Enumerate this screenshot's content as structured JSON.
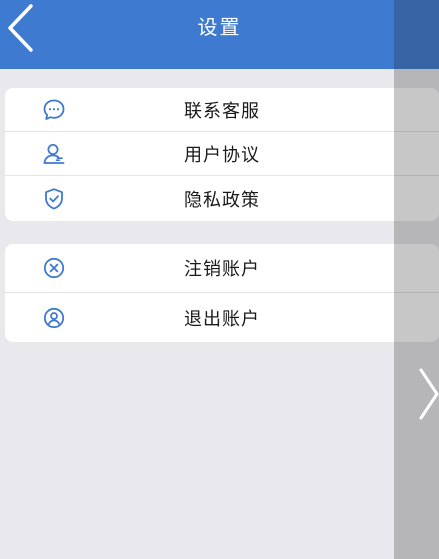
{
  "header": {
    "title": "设置",
    "back_icon": "chevron-left-icon",
    "background": "#3d7ad0"
  },
  "groups": [
    {
      "items": [
        {
          "label": "联系客服",
          "icon": "chat-bubble-icon"
        },
        {
          "label": "用户协议",
          "icon": "user-agreement-icon"
        },
        {
          "label": "隐私政策",
          "icon": "shield-check-icon"
        }
      ]
    },
    {
      "items": [
        {
          "label": "注销账户",
          "icon": "close-circle-icon"
        },
        {
          "label": "退出账户",
          "icon": "user-circle-icon"
        }
      ]
    }
  ],
  "colors": {
    "accent": "#3d7ad0",
    "page_background": "#e9e9ed",
    "icon": "#3d7ad0"
  },
  "overlay": {
    "next_icon": "chevron-right-icon"
  }
}
